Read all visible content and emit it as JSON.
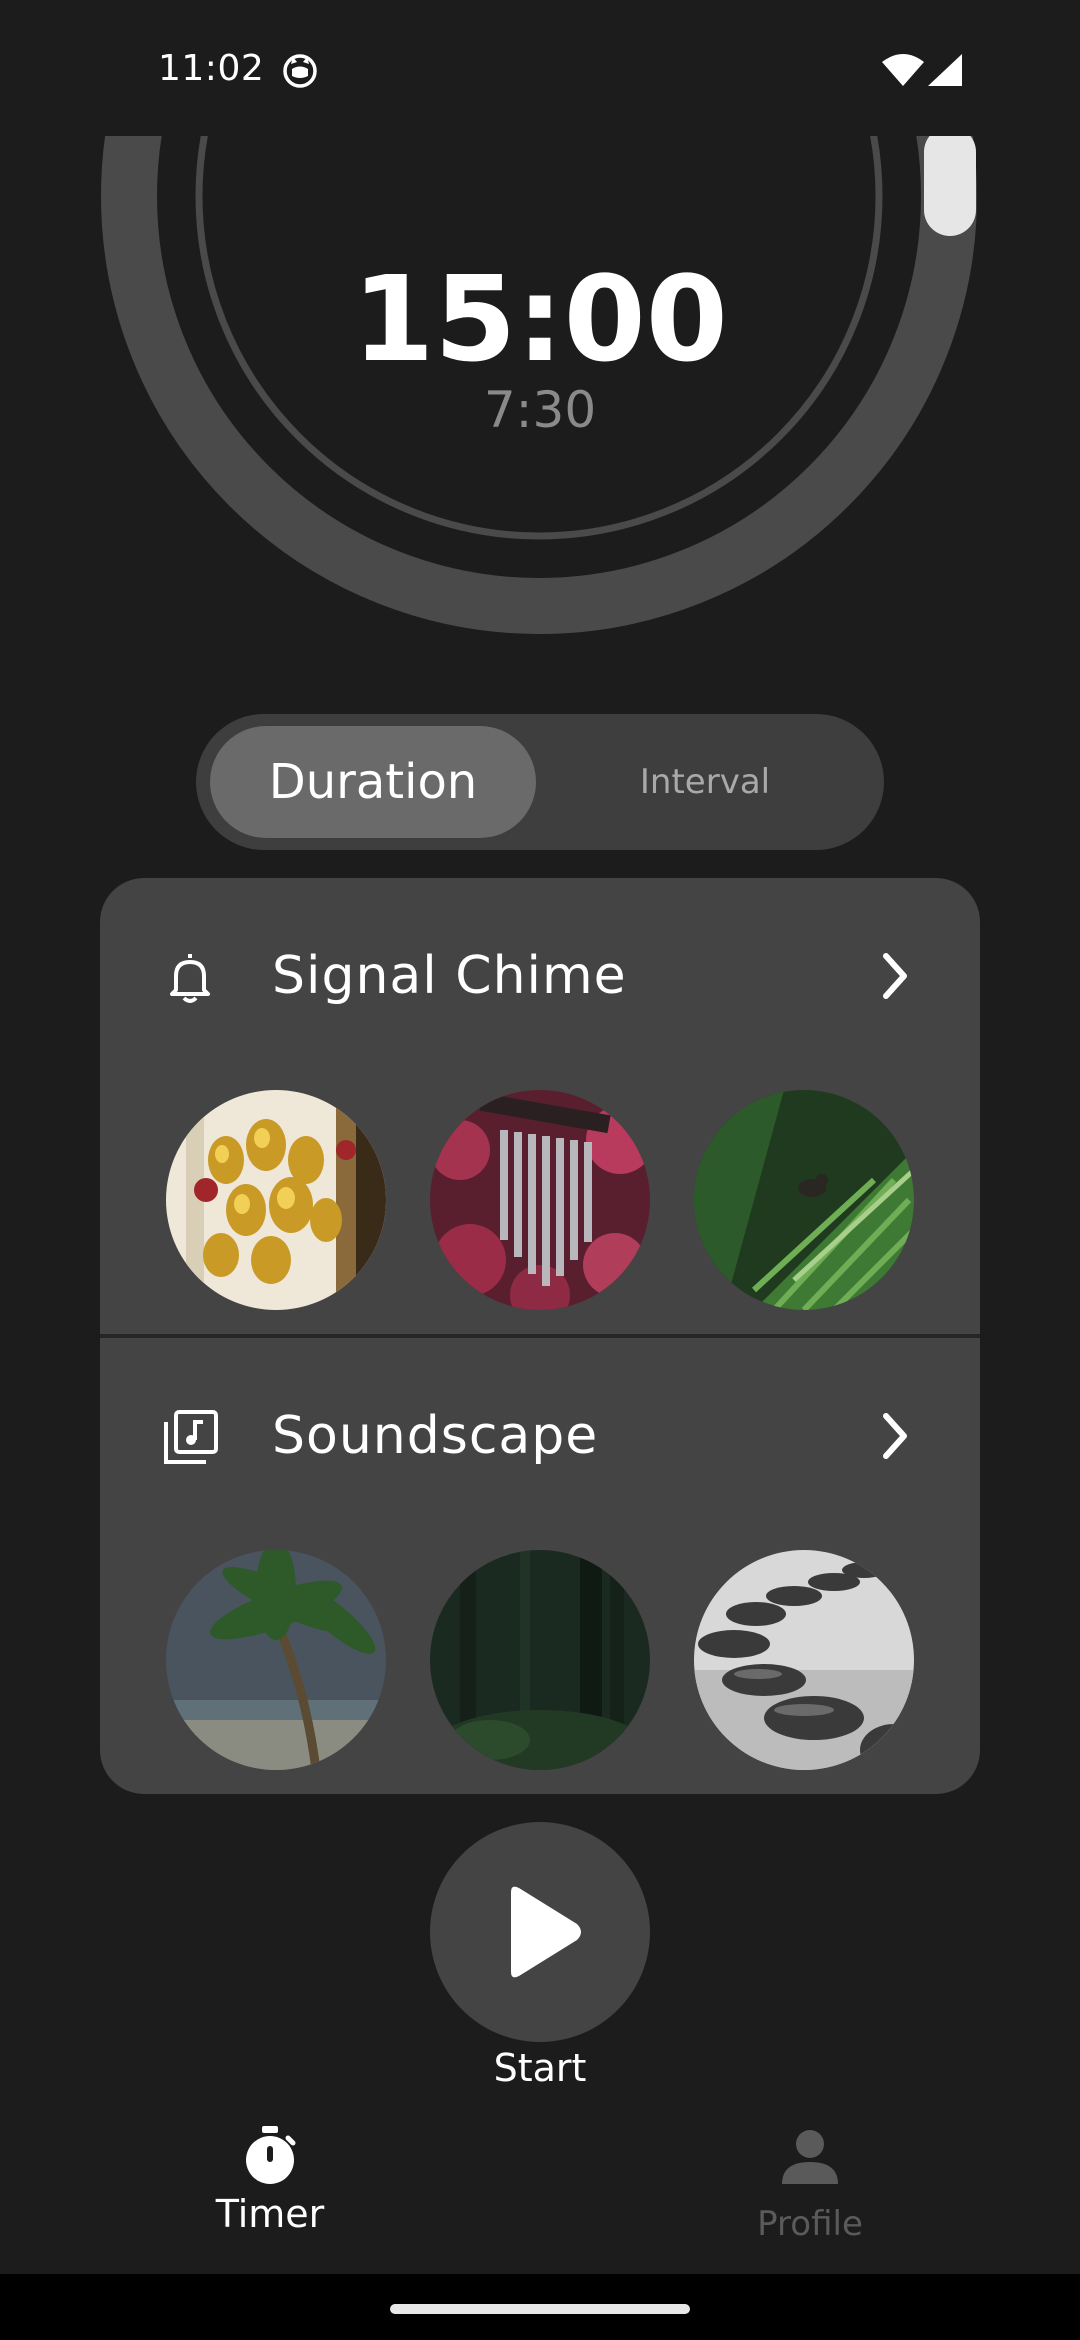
{
  "status_bar": {
    "time": "11:02",
    "icons": [
      "cat-app-icon",
      "wifi-icon",
      "cell-signal-icon"
    ]
  },
  "timer": {
    "main_time": "15:00",
    "interval_time": "7:30",
    "progress_fraction": 0.0,
    "colors": {
      "track": "#4a4a4b",
      "inner_ring": "#4a4a4b",
      "handle": "#e6e6e6"
    }
  },
  "mode_toggle": {
    "options": [
      "Duration",
      "Interval"
    ],
    "selected": "Duration"
  },
  "signal_chime": {
    "title": "Signal Chime",
    "icon": "bell-icon",
    "thumbnails": [
      "golden-bells",
      "wind-chime",
      "bird-on-leaf"
    ]
  },
  "soundscape": {
    "title": "Soundscape",
    "icon": "music-library-icon",
    "thumbnails": [
      "palm-beach",
      "dark-forest",
      "zen-stones"
    ]
  },
  "start": {
    "label": "Start",
    "icon": "play-icon"
  },
  "bottom_nav": {
    "items": [
      {
        "label": "Timer",
        "icon": "stopwatch-icon",
        "active": true
      },
      {
        "label": "Profile",
        "icon": "person-icon",
        "active": false
      }
    ]
  },
  "colors": {
    "background": "#1c1c1d",
    "card": "#444445",
    "segment_selected": "#6a6a6b",
    "muted_text": "#8a8a8a"
  }
}
